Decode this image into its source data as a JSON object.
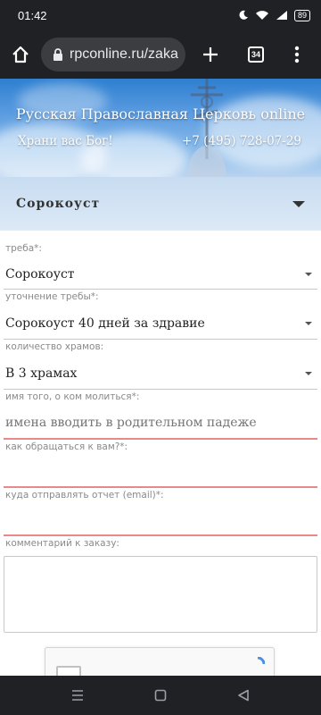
{
  "status": {
    "time": "01:42",
    "battery": "89"
  },
  "browser": {
    "url": "rpconline.ru/zaka",
    "tab_count": "34"
  },
  "banner": {
    "title": "Русская Православная Церковь online",
    "greeting": "Храни вас Бог!",
    "phone": "+7 (495) 728-07-29"
  },
  "section": {
    "title": "Сорокоуст"
  },
  "form": {
    "treba_label": "треба*:",
    "treba_value": "Сорокоуст",
    "utochnenie_label": "уточнение требы*:",
    "utochnenie_value": "Сорокоуст 40 дней за здравие",
    "hramy_label": "количество храмов:",
    "hramy_value": "В 3 храмах",
    "imya_label": "имя того, о ком молиться*:",
    "imya_placeholder": "имена вводить в родительном падеже",
    "obrashch_label": "как обращаться к вам?*:",
    "email_label": "куда отправлять отчет (email)*:",
    "comment_label": "комментарий к заказу:"
  }
}
